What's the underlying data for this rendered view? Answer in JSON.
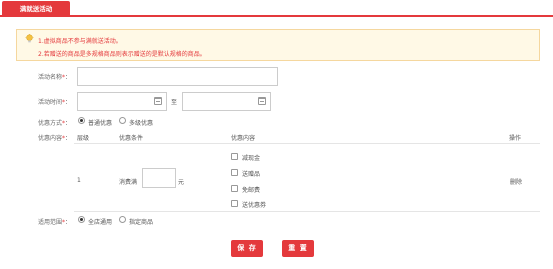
{
  "tab": {
    "label": "满就送活动"
  },
  "notice": {
    "line1": "1.虚拟商品不参与满就送活动。",
    "line2": "2.若赠送的商品是多规格商品则表示赠送的是默认规格的商品。"
  },
  "form": {
    "name": {
      "label": "活动名称",
      "required_mark": "*",
      "colon": "：",
      "value": ""
    },
    "time": {
      "label": "活动时间",
      "required_mark": "*",
      "colon": "：",
      "separator": "至",
      "start_value": "",
      "end_value": ""
    },
    "mode": {
      "label": "优惠方式",
      "required_mark": "*",
      "colon": "：",
      "options": [
        "普通优惠",
        "多级优惠"
      ],
      "selected": "普通优惠"
    },
    "content": {
      "label": "优惠内容",
      "required_mark": "*",
      "colon": "：",
      "columns": [
        "层级",
        "优惠条件",
        "优惠内容",
        "操作"
      ],
      "rows": [
        {
          "level": "1",
          "condition_prefix": "消费满",
          "condition_value": "",
          "condition_unit": "元",
          "benefits": [
            "减现金",
            "送赠品",
            "免邮费",
            "送优惠券"
          ],
          "action": "删除"
        }
      ]
    },
    "scope": {
      "label": "适用范围",
      "required_mark": "*",
      "colon": "：",
      "options": [
        "全店通用",
        "指定商品"
      ],
      "selected": "全店通用"
    }
  },
  "buttons": {
    "save": "保 存",
    "reset": "重 置"
  },
  "colors": {
    "accent": "#e4393c",
    "notice_bg": "#fff9e6",
    "notice_border": "#f5d79e"
  }
}
